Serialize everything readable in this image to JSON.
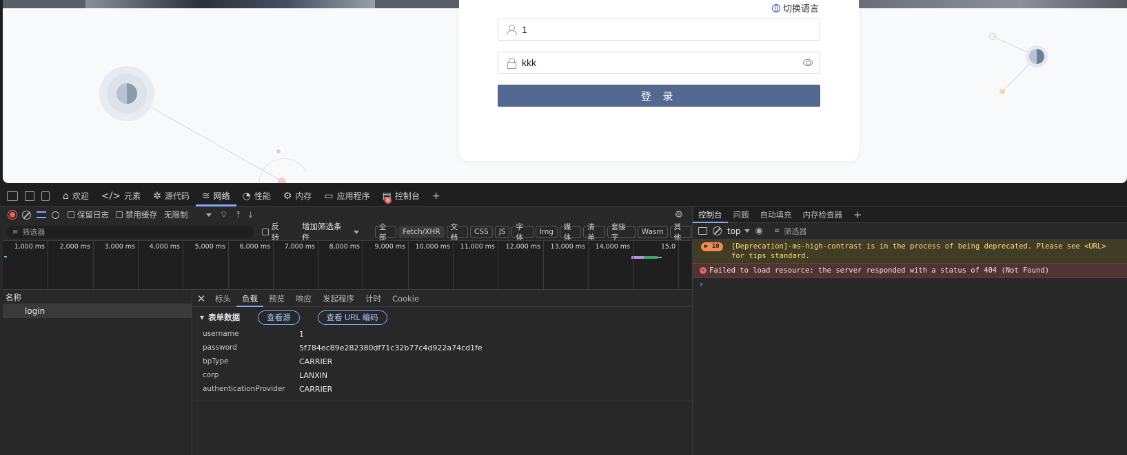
{
  "page": {
    "lang_switch": "切换语言",
    "username_value": "1",
    "password_value": "kkk",
    "login_button": "登 录"
  },
  "devtools": {
    "main_tabs": [
      {
        "label": "欢迎",
        "icon": "home-icon"
      },
      {
        "label": "元素",
        "icon": "code-icon"
      },
      {
        "label": "源代码",
        "icon": "bug-icon"
      },
      {
        "label": "网络",
        "icon": "wifi-icon"
      },
      {
        "label": "性能",
        "icon": "gauge-icon"
      },
      {
        "label": "内存",
        "icon": "memory-icon"
      },
      {
        "label": "应用程序",
        "icon": "app-icon"
      },
      {
        "label": "控制台",
        "icon": "console-icon"
      }
    ],
    "active_tab": "网络",
    "network": {
      "preserve_log": "保留日志",
      "disable_cache": "禁用缓存",
      "throttling": "无限制",
      "filter_placeholder": "筛选器",
      "invert": "反转",
      "more_filters": "增加筛选条件",
      "type_filters": [
        "全部",
        "Fetch/XHR",
        "文档",
        "CSS",
        "JS",
        "字体",
        "Img",
        "媒体",
        "清单",
        "套接字",
        "Wasm",
        "其他"
      ],
      "selected_type": "Fetch/XHR",
      "timeline_labels": [
        "1,000 ms",
        "2,000 ms",
        "3,000 ms",
        "4,000 ms",
        "5,000 ms",
        "6,000 ms",
        "7,000 ms",
        "8,000 ms",
        "9,000 ms",
        "10,000 ms",
        "11,000 ms",
        "12,000 ms",
        "13,000 ms",
        "14,000 ms",
        "15,0"
      ],
      "name_header": "名称",
      "requests": [
        {
          "name": "login"
        }
      ],
      "detail_tabs": [
        "标头",
        "负载",
        "预览",
        "响应",
        "发起程序",
        "计时",
        "Cookie"
      ],
      "active_detail_tab": "负载",
      "form_data_title": "表单数据",
      "view_source": "查看源",
      "view_url_encoded": "查看 URL 编码",
      "form_data": [
        {
          "key": "username",
          "value": "1"
        },
        {
          "key": "password",
          "value": "5f784ec89e282380df71c32b77c4d922a74cd1fe"
        },
        {
          "key": "bpType",
          "value": "CARRIER"
        },
        {
          "key": "corp",
          "value": "LANXIN"
        },
        {
          "key": "authenticationProvider",
          "value": "CARRIER"
        }
      ]
    },
    "console": {
      "tabs": [
        "控制台",
        "问题",
        "自动填充",
        "内存检查器"
      ],
      "context": "top",
      "filter_placeholder": "筛选器",
      "warning_count": "10",
      "warning_text": "[Deprecation]-ms-high-contrast is in the process of being deprecated. Please see <URL> for tips standard.",
      "error_text": "Failed to load resource: the server responded with a status of 404 (Not Found)",
      "prompt": "›"
    }
  }
}
